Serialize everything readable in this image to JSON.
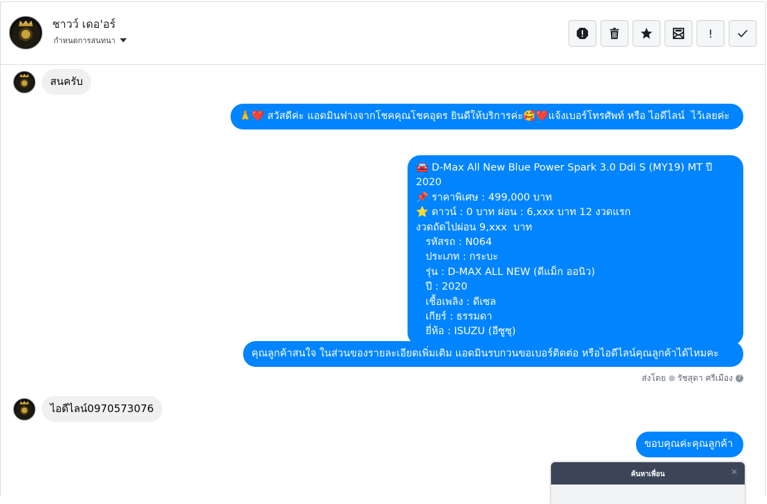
{
  "header": {
    "contact_name": "ชาวว์ เดอ'อร์",
    "assign_label": "กำหนดการสนทนา"
  },
  "toolbar": {
    "buttons": [
      "spam-icon",
      "trash-icon",
      "star-icon",
      "mark-unread-icon",
      "important-icon",
      "done-icon"
    ],
    "important_glyph": "!"
  },
  "messages": {
    "m1_in": "สนครับ",
    "m2_out": "🙏❤️ สวัสดีค่ะ แอดมินฟางจากโชคคุณโชคอุดร ยินดีให้บริการค่ะ🥰❤️แจ้งเบอร์โทรศัพท์ หรือ ไอดีไลน์  ไว้เลยค่ะ",
    "m3_out": "🚘 D-Max All New Blue Power Spark 3.0 Ddi S (MY19) MT ปี 2020\n📌 ราคาพิเศษ : 499,000 บาท\n⭐ ดาวน์ : 0 บาท ผ่อน : 6,xxx บาท 12 งวดแรก\nงวดถัดไปผ่อน 9,xxx  บาท\n   รหัสรถ : N064\n   ประเภท : กระบะ\n   รุ่น : D-MAX ALL NEW (ดีแม็ก ออนิว)\n   ปี : 2020\n   เชื้อเพลิง : ดีเซล\n   เกียร์ : ธรรมดา\n   ยี่ห้อ : ISUZU (อีซูซุ)",
    "m4_out": "คุณลูกค้าสนใจ ในส่วนของรายละเอียดเพิ่มเติม แอดมินรบกวนขอเบอร์ติดต่อ หรือไอดีไลน์คุณลูกค้าได้ไหมคะ",
    "sent_by_label": "ส่งโดย",
    "sent_by_name": "รัชสุดา ศรีเมือง",
    "help_glyph": "?",
    "m5_in": "ไอดีไลน์0970573076",
    "m6_out": "ขอบคุณค่ะคุณลูกค้า"
  },
  "popup": {
    "title": "ค้นหาเพื่อน",
    "close_glyph": "✕"
  },
  "colors": {
    "outgoing_bubble": "#0084ff",
    "incoming_bubble": "#f0f0f0",
    "popup_header": "#3b4557"
  }
}
